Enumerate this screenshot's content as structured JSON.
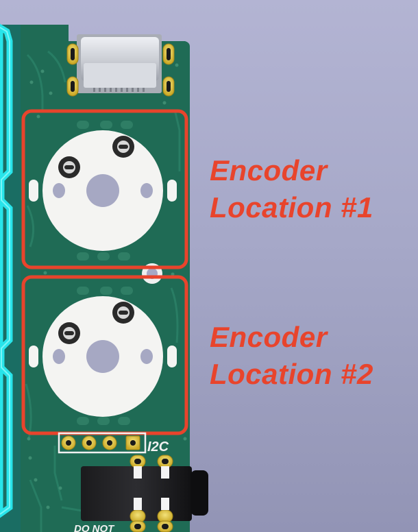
{
  "annotations": {
    "color": "#e8442c",
    "encoder1": {
      "line1": "Encoder",
      "line2": "Location #1"
    },
    "encoder2": {
      "line1": "Encoder",
      "line2": "Location #2"
    }
  },
  "board": {
    "pcb_color": "#1f6b55",
    "silkscreen": {
      "i2c": "I2C",
      "do_not": "DO NOT"
    }
  }
}
